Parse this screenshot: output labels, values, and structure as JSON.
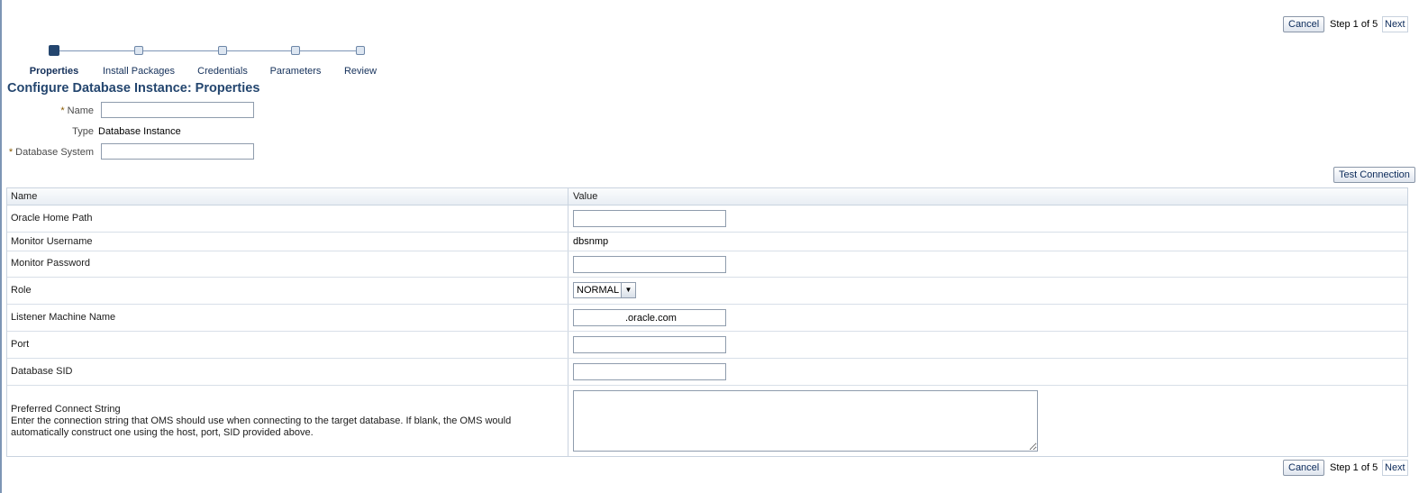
{
  "top_nav": {
    "cancel_label": "Cancel",
    "step_text": "Step 1 of 5",
    "next_label": "Next"
  },
  "train": {
    "steps": [
      {
        "label": "Properties"
      },
      {
        "label": "Install Packages"
      },
      {
        "label": "Credentials"
      },
      {
        "label": "Parameters"
      },
      {
        "label": "Review"
      }
    ],
    "active_index": 0
  },
  "page_title": "Configure Database Instance: Properties",
  "form": {
    "name_label": "Name",
    "name_value": "",
    "type_label": "Type",
    "type_value": "Database Instance",
    "database_system_label": "Database System",
    "database_system_value": "",
    "required_marker": "*"
  },
  "test_connection_label": "Test Connection",
  "properties_table": {
    "columns": [
      "Name",
      "Value"
    ],
    "rows": {
      "oracle_home_path": {
        "name": "Oracle Home Path",
        "value": ""
      },
      "monitor_username": {
        "name": "Monitor Username",
        "value": "dbsnmp"
      },
      "monitor_password": {
        "name": "Monitor Password",
        "value": ""
      },
      "role": {
        "name": "Role",
        "value": "NORMAL"
      },
      "listener_machine_name": {
        "name": "Listener Machine Name",
        "value": ".oracle.com"
      },
      "port": {
        "name": "Port",
        "value": ""
      },
      "database_sid": {
        "name": "Database SID",
        "value": ""
      },
      "preferred_connect_string": {
        "name": "Preferred Connect String",
        "description": "Enter the connection string that OMS should use when connecting to the target database. If blank, the OMS would automatically construct one using the host, port, SID provided above.",
        "value": ""
      }
    }
  },
  "bottom_nav": {
    "cancel_label": "Cancel",
    "step_text": "Step 1 of 5",
    "next_label": "Next"
  }
}
